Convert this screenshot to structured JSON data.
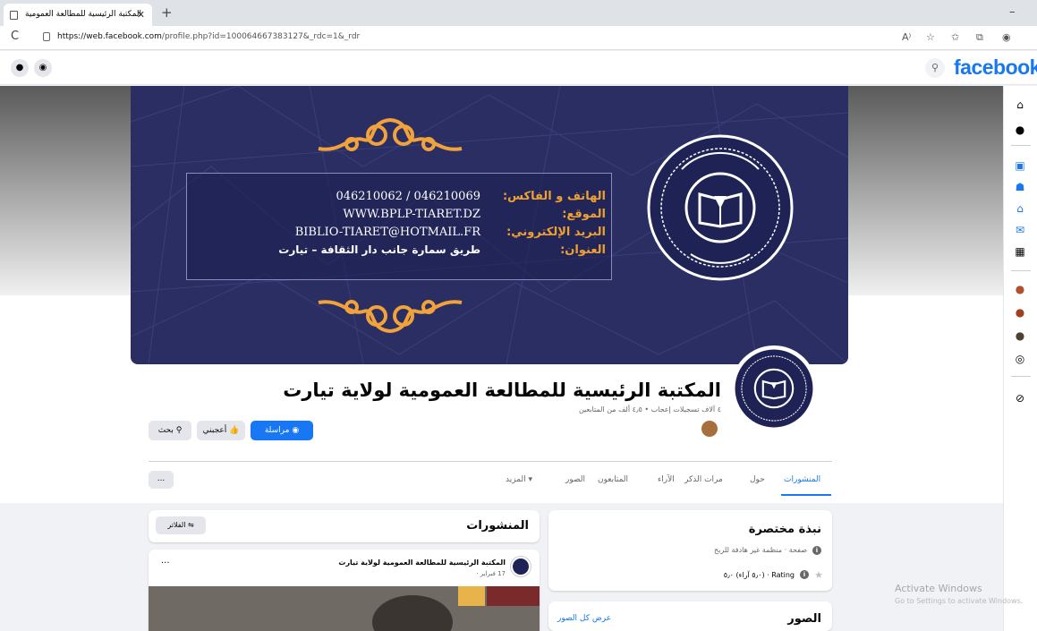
{
  "browser": {
    "tab_title": "المكتبة الرئيسية للمطالعة العمومية",
    "url_host": "https://web.facebook.com",
    "url_path": "/profile.php?id=100064667383127&_rdc=1&_rdr"
  },
  "fb": {
    "logo": "facebook"
  },
  "cover": {
    "fax_label": "الهاتف و الفاكس:",
    "fax_value": "046210062 / 046210069",
    "site_label": "الموقع:",
    "site_value": "WWW.BPLP-TIARET.DZ",
    "email_label": "البريد الإلكتروني:",
    "email_value": "BIBLIO-TIARET@HOTMAIL.FR",
    "address_label": "العنوان:",
    "address_value": "طريق سمارة جانب دار الثقافة – تيارت"
  },
  "profile": {
    "name": "المكتبة الرئيسية للمطالعة العمومية لولاية تيارت",
    "stats": "٤ آلاف تسجيلات إعجاب • ٤٫٥ ألف من المتابعين"
  },
  "actions": {
    "message": "مراسلة",
    "like": "أعجبني",
    "search": "بحث"
  },
  "tabs": [
    "المنشورات",
    "حول",
    "مرات الذكر",
    "الآراء",
    "المتابعون",
    "الصور",
    "المزيد ▾"
  ],
  "more": "...",
  "intro": {
    "title": "نبذة مختصرة",
    "page_type": "صفحة · منظمة غير هادفة للربح",
    "rating": "Rating · (٥٫٠ آراء) ٥٫٠"
  },
  "photos": {
    "title": "الصور",
    "see_all": "عرض كل الصور"
  },
  "posts": {
    "title": "المنشورات",
    "filter": "الفلاتر",
    "author": "المكتبة الرئيسية للمطالعة العمومية لولاية تيارت",
    "date": "17 فبراير ·"
  },
  "windows": {
    "line1": "Activate Windows",
    "line2": "Go to Settings to activate Windows."
  }
}
